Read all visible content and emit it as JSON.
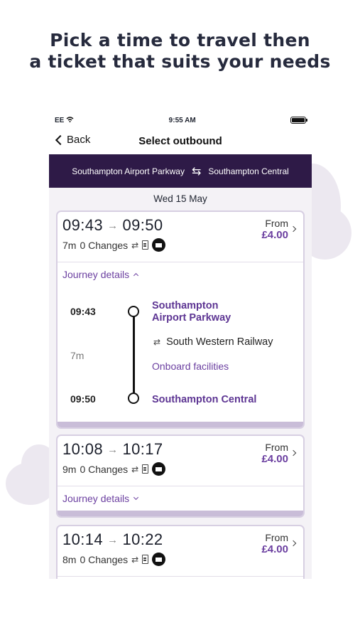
{
  "headline": {
    "line1": "Pick a time to travel then",
    "line2": "a ticket that suits your needs"
  },
  "status_bar": {
    "carrier": "EE",
    "wifi_icon": "wifi-icon",
    "time": "9:55 AM",
    "battery_icon": "battery-icon"
  },
  "nav": {
    "back_label": "Back",
    "title": "Select outbound"
  },
  "route": {
    "origin": "Southampton Airport Parkway",
    "destination": "Southampton Central",
    "swap_icon": "⇆",
    "background_color": "#2e1a47"
  },
  "date": "Wed 15 May",
  "accent_color": "#6b3fa0",
  "journeys": [
    {
      "depart": "09:43",
      "arrive": "09:50",
      "duration": "7m",
      "changes": "0 Changes",
      "from_label": "From",
      "price": "£4.00",
      "details_label": "Journey details",
      "expanded": true,
      "details": {
        "depart_time": "09:43",
        "arrive_time": "09:50",
        "duration": "7m",
        "origin_line1": "Southampton",
        "origin_line2": "Airport Parkway",
        "operator": "South Western Railway",
        "facilities_label": "Onboard facilities",
        "destination": "Southampton Central"
      }
    },
    {
      "depart": "10:08",
      "arrive": "10:17",
      "duration": "9m",
      "changes": "0 Changes",
      "from_label": "From",
      "price": "£4.00",
      "details_label": "Journey details",
      "expanded": false
    },
    {
      "depart": "10:14",
      "arrive": "10:22",
      "duration": "8m",
      "changes": "0 Changes",
      "from_label": "From",
      "price": "£4.00",
      "expanded": false
    }
  ]
}
